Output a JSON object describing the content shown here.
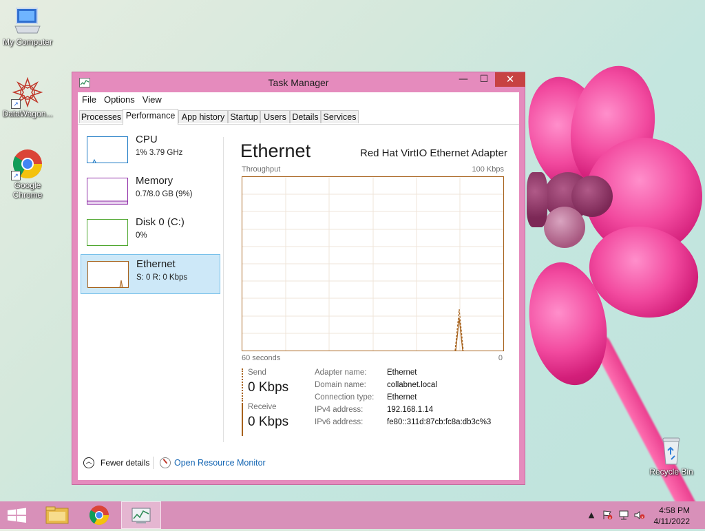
{
  "desktop": {
    "icons": [
      {
        "label": "My Computer"
      },
      {
        "label": "DataWagon..."
      },
      {
        "label": "Google Chrome"
      },
      {
        "label": "Recycle Bin"
      }
    ]
  },
  "window": {
    "title": "Task Manager",
    "menu": [
      "File",
      "Options",
      "View"
    ],
    "tabs": [
      "Processes",
      "Performance",
      "App history",
      "Startup",
      "Users",
      "Details",
      "Services"
    ],
    "active_tab": "Performance"
  },
  "resources": [
    {
      "name": "CPU",
      "detail": "1% 3.79 GHz",
      "color": "#1a78c4"
    },
    {
      "name": "Memory",
      "detail": "0.7/8.0 GB (9%)",
      "color": "#8e2ba6"
    },
    {
      "name": "Disk 0 (C:)",
      "detail": "0%",
      "color": "#4ea72e"
    },
    {
      "name": "Ethernet",
      "detail": "S: 0 R: 0 Kbps",
      "color": "#a7621c",
      "selected": true
    }
  ],
  "ethernet": {
    "title": "Ethernet",
    "adapter": "Red Hat VirtIO Ethernet Adapter",
    "graph_label": "Throughput",
    "graph_max": "100 Kbps",
    "time_label": "60 seconds",
    "zero_label": "0",
    "send_label": "Send",
    "send_value": "0 Kbps",
    "receive_label": "Receive",
    "receive_value": "0 Kbps",
    "info": [
      {
        "key": "Adapter name:",
        "value": "Ethernet"
      },
      {
        "key": "Domain name:",
        "value": "collabnet.local"
      },
      {
        "key": "Connection type:",
        "value": "Ethernet"
      },
      {
        "key": "IPv4 address:",
        "value": "192.168.1.14"
      },
      {
        "key": "IPv6 address:",
        "value": "fe80::311d:87cb:fc8a:db3c%3"
      }
    ]
  },
  "footer": {
    "fewer_details": "Fewer details",
    "resource_monitor": "Open Resource Monitor"
  },
  "taskbar": {
    "time": "4:58 PM",
    "date": "4/11/2022"
  }
}
